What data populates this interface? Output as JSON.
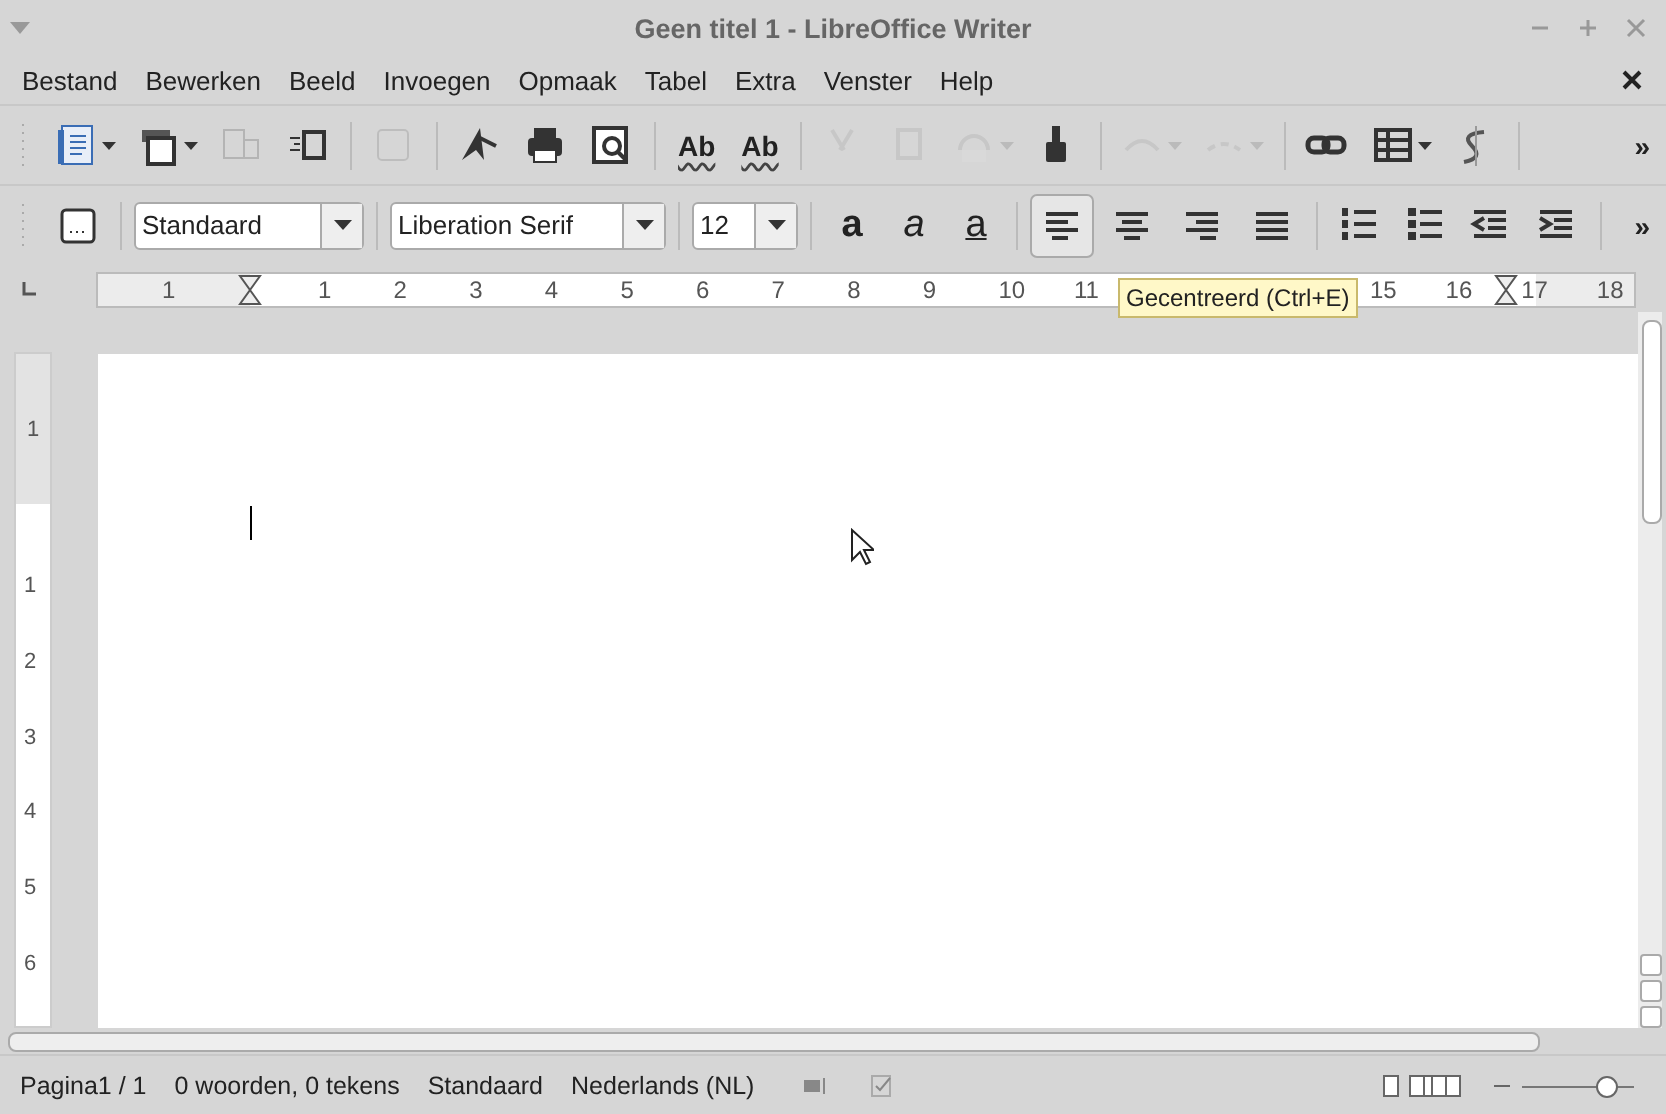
{
  "window": {
    "title": "Geen titel 1 - LibreOffice Writer"
  },
  "menu": [
    "Bestand",
    "Bewerken",
    "Beeld",
    "Invoegen",
    "Opmaak",
    "Tabel",
    "Extra",
    "Venster",
    "Help"
  ],
  "standard_toolbar": [
    {
      "kind": "icon",
      "disabled": false,
      "dropdown": true
    },
    {
      "kind": "icon",
      "disabled": false,
      "dropdown": true
    },
    {
      "kind": "icon",
      "disabled": true,
      "dropdown": false
    },
    {
      "kind": "icon",
      "disabled": false,
      "dropdown": false
    },
    {
      "kind": "separator"
    },
    {
      "kind": "icon",
      "disabled": true,
      "dropdown": false
    },
    {
      "kind": "separator"
    },
    {
      "kind": "icon",
      "disabled": false,
      "dropdown": false
    },
    {
      "kind": "icon",
      "disabled": false,
      "dropdown": false
    },
    {
      "kind": "icon",
      "disabled": false,
      "dropdown": false
    },
    {
      "kind": "separator"
    },
    {
      "kind": "text",
      "label": "Ab",
      "disabled": false,
      "dropdown": false
    },
    {
      "kind": "text",
      "label": "Ab",
      "disabled": false,
      "dropdown": false
    },
    {
      "kind": "separator"
    },
    {
      "kind": "icon",
      "disabled": true,
      "dropdown": false
    },
    {
      "kind": "icon",
      "disabled": true,
      "dropdown": false
    },
    {
      "kind": "icon",
      "disabled": true,
      "dropdown": true
    },
    {
      "kind": "icon",
      "disabled": false,
      "dropdown": false
    },
    {
      "kind": "separator"
    },
    {
      "kind": "icon",
      "disabled": true,
      "dropdown": true
    },
    {
      "kind": "icon",
      "disabled": true,
      "dropdown": true
    },
    {
      "kind": "separator"
    },
    {
      "kind": "icon",
      "disabled": false,
      "dropdown": false
    },
    {
      "kind": "icon",
      "disabled": false,
      "dropdown": true
    },
    {
      "kind": "icon",
      "disabled": false,
      "dropdown": false
    },
    {
      "kind": "separator"
    }
  ],
  "formatting_toolbar": {
    "paragraph_style": "Standaard",
    "font": "Liberation Serif",
    "size": "12",
    "format_buttons": [
      {
        "label": "a",
        "kind": "bold"
      },
      {
        "label": "a",
        "kind": "italic"
      },
      {
        "label": "a",
        "kind": "underline"
      }
    ],
    "align_buttons": [
      {
        "selected": true
      },
      {
        "selected": false
      },
      {
        "selected": false
      },
      {
        "selected": false
      }
    ]
  },
  "overflow": "»",
  "ruler": {
    "left_label": "1",
    "labels": [
      "1",
      "2",
      "3",
      "4",
      "5",
      "6",
      "7",
      "8",
      "9",
      "10",
      "11"
    ],
    "labels_after_tooltip": [
      "15",
      "16",
      "17",
      "18"
    ]
  },
  "vertical_ruler": {
    "top_label": "1",
    "labels": [
      "1",
      "2",
      "3",
      "4",
      "5",
      "6"
    ]
  },
  "tooltip": "Gecentreerd (Ctrl+E)",
  "status_bar": {
    "page": "Pagina1 / 1",
    "words": "0 woorden, 0 tekens",
    "style": "Standaard",
    "language": "Nederlands (NL)",
    "zoom": {
      "level": 0.75
    }
  }
}
